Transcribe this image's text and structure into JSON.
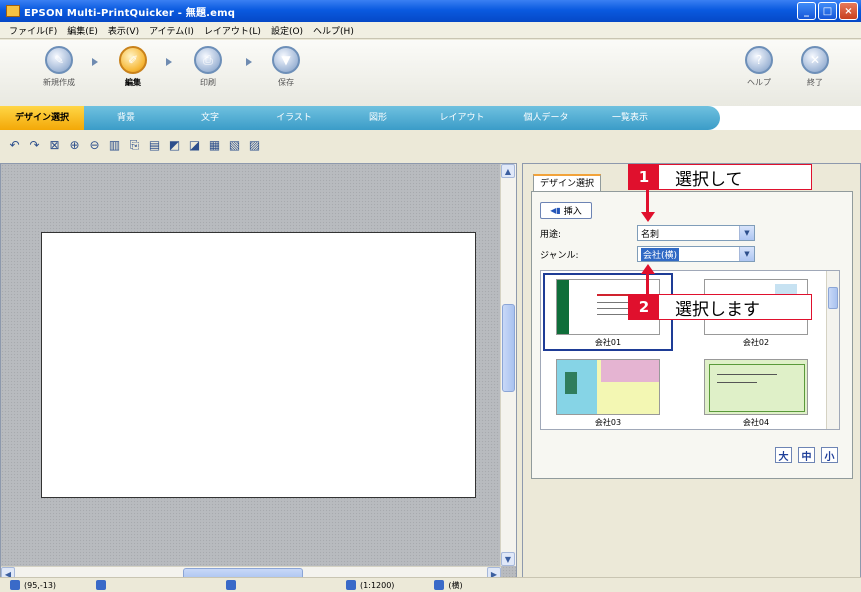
{
  "window": {
    "title": "EPSON Multi-PrintQuicker - 無題.emq",
    "minimize": "_",
    "maximize": "□",
    "close": "×"
  },
  "menu": [
    "ファイル(F)",
    "編集(E)",
    "表示(V)",
    "アイテム(I)",
    "レイアウト(L)",
    "設定(O)",
    "ヘルプ(H)"
  ],
  "workflow": {
    "steps": [
      "新規作成",
      "編集",
      "印刷",
      "保存"
    ],
    "active": "編集",
    "help_label": "ヘルプ",
    "exit_label": "終了"
  },
  "tabs": [
    "デザイン選択",
    "背景",
    "文字",
    "イラスト",
    "図形",
    "レイアウト",
    "個人データ",
    "一覧表示"
  ],
  "active_tab": "デザイン選択",
  "panel": {
    "tab_label": "デザイン選択",
    "insert_label": "挿入",
    "usage_label": "用途:",
    "usage_value": "名刺",
    "genre_label": "ジャンル:",
    "genre_value": "会社(横)",
    "templates": [
      "会社01",
      "会社02",
      "会社03",
      "会社04"
    ],
    "selected_template": "会社01",
    "size_large": "大",
    "size_medium": "中",
    "size_small": "小"
  },
  "callouts": [
    {
      "num": "1",
      "text": "選択して"
    },
    {
      "num": "2",
      "text": "選択します"
    }
  ],
  "status": {
    "position": "(95,-13)",
    "zoom": "(1:1200)",
    "mode": "(横)"
  },
  "colors": {
    "accent_red": "#e0102d",
    "tab_active": "#f3a807",
    "tab_band": "#3b9cc8",
    "titlebar": "#0a5ae0"
  }
}
